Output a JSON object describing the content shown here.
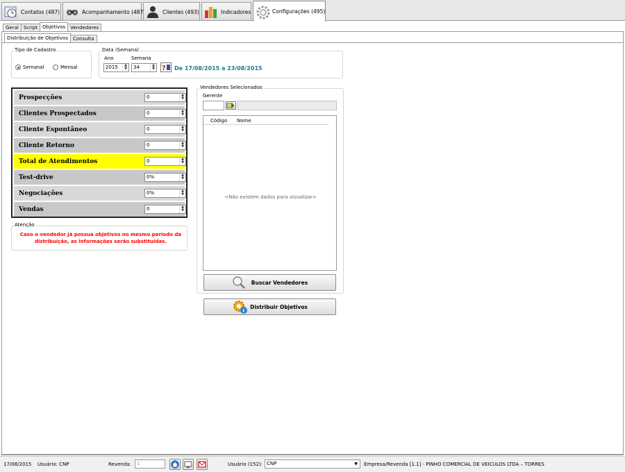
{
  "top_tabs": [
    {
      "label": "Contatos (487)",
      "icon": "clock-calendar-icon"
    },
    {
      "label": "Acompanhamento (487)",
      "icon": "binoculars-icon"
    },
    {
      "label": "Clientes (493)",
      "icon": "person-icon"
    },
    {
      "label": "Indicadores",
      "icon": "bar-chart-icon"
    },
    {
      "label": "Configurações (495)",
      "icon": "gear-icon"
    }
  ],
  "sub_tabs": [
    "Geral",
    "Script",
    "Objetivos",
    "Vendedores"
  ],
  "sub_sub_tabs": [
    "Distribuição de Objetivos",
    "Consulta"
  ],
  "tipo_cadastro": {
    "title": "Tipo de Cadastro",
    "options": [
      "Semanal",
      "Mensal"
    ],
    "selected": "Semanal"
  },
  "data_semana": {
    "title": "Data (Semana)",
    "ano_label": "Ano",
    "semana_label": "Semana",
    "ano_value": "2015",
    "semana_value": "34",
    "range_text": "De 17/08/2015 a 23/08/2015"
  },
  "objetivos": [
    {
      "label": "Prospecções",
      "value": "0"
    },
    {
      "label": "Clientes Prospectados",
      "value": "0"
    },
    {
      "label": "Cliente Espontâneo",
      "value": "0"
    },
    {
      "label": "Cliente Retorno",
      "value": "0"
    },
    {
      "label": "Total de Atendimentos",
      "value": "0"
    },
    {
      "label": "Test-drive",
      "value": "0%"
    },
    {
      "label": "Negociações",
      "value": "0%"
    },
    {
      "label": "Vendas",
      "value": "0"
    }
  ],
  "atencao": {
    "title": "Atenção",
    "text": "Caso o vendedor já possua objetivos no mesmo período da distribuição, as informações serão substituídas."
  },
  "vendedores": {
    "title": "Vendedores Selecionados",
    "gerente_label": "Gerente",
    "gerente_code": "",
    "gerente_name": "",
    "columns": [
      "Código",
      "Nome"
    ],
    "empty_message": "<Não existem dados para visualizar>",
    "buscar_button": "Buscar Vendedores"
  },
  "distribuir_button": "Distribuir Objetivos",
  "status_bar": {
    "date": "17/08/2015",
    "usuario_short": "Usuário: CNP",
    "revenda_label": "Revenda:",
    "revenda_value": "1",
    "usuario_label": "Usuário (152):",
    "usuario_value": "CNP",
    "empresa": "Empresa/Revenda [1.1] - PINHO COMERCIAL DE VEICULOS LTDA – TORRES"
  },
  "colors": {
    "highlight_row": "#ffff00",
    "warning_text": "#ff0000",
    "range_text": "#1a7a8a"
  }
}
